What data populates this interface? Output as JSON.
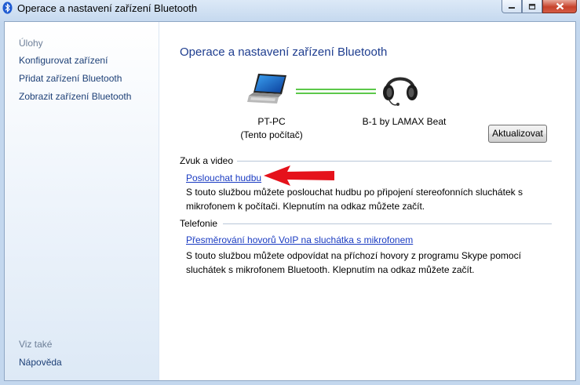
{
  "window": {
    "title": "Operace a nastavení zařízení Bluetooth",
    "icons": {
      "app": "bluetooth-icon",
      "minimize": "minimize-icon",
      "maximize": "maximize-icon",
      "close": "close-icon"
    }
  },
  "sidebar": {
    "tasks_heading": "Úlohy",
    "tasks": [
      {
        "label": "Konfigurovat zařízení"
      },
      {
        "label": "Přidat zařízení Bluetooth"
      },
      {
        "label": "Zobrazit zařízení Bluetooth"
      }
    ],
    "see_also_heading": "Viz také",
    "see_also": [
      {
        "label": "Nápověda"
      }
    ]
  },
  "main": {
    "title": "Operace a nastavení zařízení Bluetooth",
    "local_device": {
      "name": "PT-PC",
      "subtitle": "(Tento počítač)",
      "icon": "laptop-icon"
    },
    "remote_device": {
      "name": "B-1 by LAMAX Beat",
      "icon": "headset-icon"
    },
    "refresh_button": "Aktualizovat",
    "sections": [
      {
        "heading": "Zvuk a video",
        "link": "Poslouchat hudbu",
        "desc_line1": "S touto službou můžete poslouchat hudbu po připojení stereofonních sluchátek s",
        "desc_line2": "mikrofonem k počítači. Klepnutím na odkaz můžete začít."
      },
      {
        "heading": "Telefonie",
        "link": "Přesměrování hovorů VoIP na sluchátka s mikrofonem",
        "desc_line1": "S touto službou můžete odpovídat na příchozí hovory z programu Skype pomocí",
        "desc_line2": "sluchátek s mikrofonem Bluetooth. Klepnutím na odkaz můžete začít."
      }
    ],
    "annotation": {
      "icon": "red-arrow-icon",
      "color": "#e5121b"
    }
  },
  "colors": {
    "link": "#1a3bc2",
    "title": "#1e3d8f",
    "connection": "#5cc84a"
  }
}
